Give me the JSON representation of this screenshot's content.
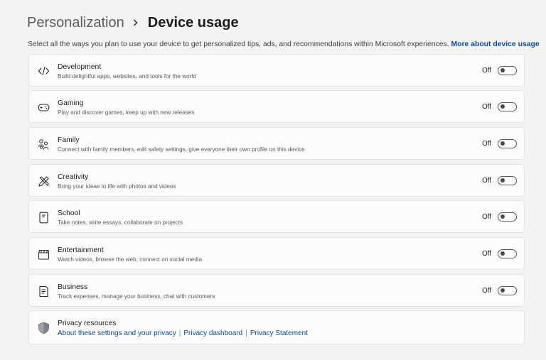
{
  "breadcrumb": {
    "parent": "Personalization",
    "current": "Device usage"
  },
  "description": {
    "text": "Select all the ways you plan to use your device to get personalized tips, ads, and recommendations within Microsoft experiences.",
    "link": "More about device usage"
  },
  "items": [
    {
      "icon": "code-icon",
      "title": "Development",
      "subtitle": "Build delightful apps, websites, and tools for the world",
      "state": "Off",
      "on": false
    },
    {
      "icon": "gamepad-icon",
      "title": "Gaming",
      "subtitle": "Play and discover games, keep up with new releases",
      "state": "Off",
      "on": false
    },
    {
      "icon": "family-icon",
      "title": "Family",
      "subtitle": "Connect with family members, edit safety settings, give everyone their own profile on this device",
      "state": "Off",
      "on": false
    },
    {
      "icon": "pen-ruler-icon",
      "title": "Creativity",
      "subtitle": "Bring your ideas to life with photos and videos",
      "state": "Off",
      "on": false
    },
    {
      "icon": "notebook-icon",
      "title": "School",
      "subtitle": "Take notes, write essays, collaborate on projects",
      "state": "Off",
      "on": false
    },
    {
      "icon": "clapperboard-icon",
      "title": "Entertainment",
      "subtitle": "Watch videos, browse the web, connect on social media",
      "state": "Off",
      "on": false
    },
    {
      "icon": "receipt-icon",
      "title": "Business",
      "subtitle": "Track expenses, manage your business, chat with customers",
      "state": "Off",
      "on": false
    }
  ],
  "privacy": {
    "icon": "shield-icon",
    "title": "Privacy resources",
    "links": [
      "About these settings and your privacy",
      "Privacy dashboard",
      "Privacy Statement"
    ]
  }
}
